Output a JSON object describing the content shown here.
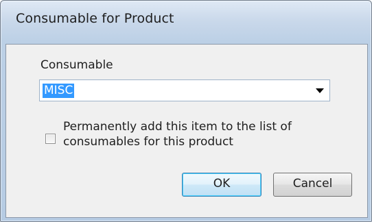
{
  "window": {
    "title": "Consumable for Product"
  },
  "form": {
    "consumable_label": "Consumable",
    "consumable_value": "MISC",
    "permanent_label": "Permanently add this item to the list of consumables for this product",
    "permanent_checked": false
  },
  "buttons": {
    "ok_label": "OK",
    "cancel_label": "Cancel"
  },
  "icons": {
    "dropdown": "chevron-down-icon",
    "checkbox": "checkbox-unchecked"
  },
  "colors": {
    "selection": "#3399ff",
    "default_button_border": "#3c7fb1"
  }
}
